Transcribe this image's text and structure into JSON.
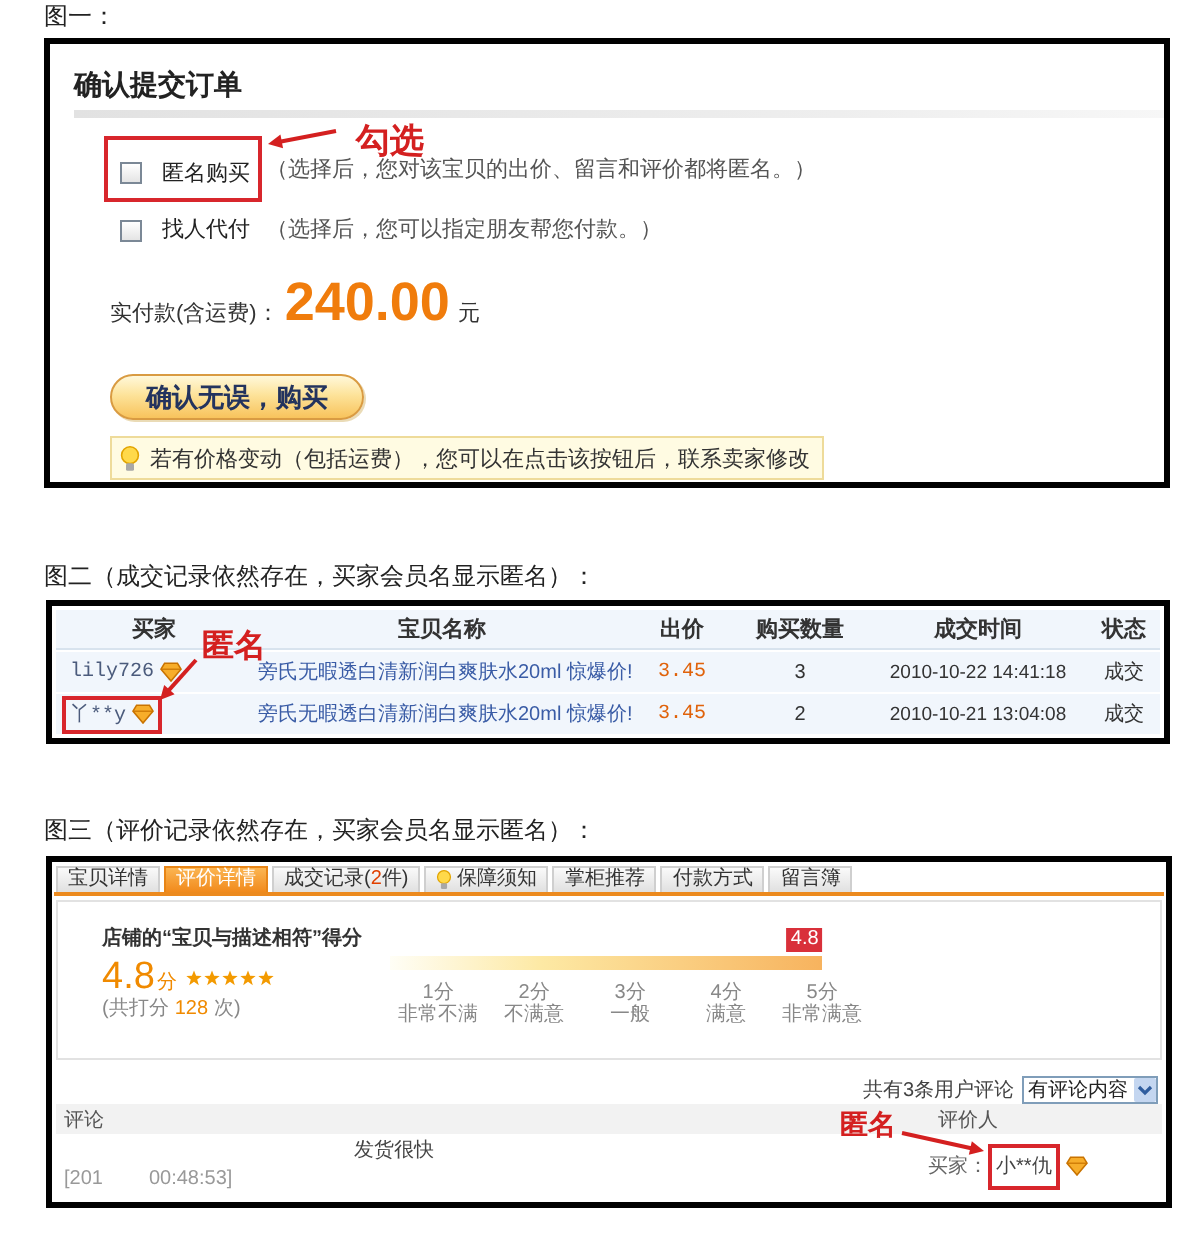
{
  "order_figure": {
    "caption": "图一：",
    "title": "确认提交订单",
    "options": [
      {
        "label": "匿名购买",
        "hint": "（选择后，您对该宝贝的出价、留言和评价都将匿名。）",
        "checked": false,
        "highlighted": true
      },
      {
        "label": "找人代付",
        "hint": "（选择后，您可以指定朋友帮您付款。）",
        "checked": false,
        "highlighted": false
      }
    ],
    "annotation": "勾选",
    "total_label": "实付款(含运费)：",
    "total_amount": "240.00",
    "currency": "元",
    "submit_button": "确认无误，购买",
    "tip": "若有价格变动（包括运费），您可以在点击该按钮后，联系卖家修改"
  },
  "records_figure": {
    "caption": "图二（成交记录依然存在，买家会员名显示匿名）：",
    "columns": [
      "买家",
      "宝贝名称",
      "出价",
      "购买数量",
      "成交时间",
      "状态"
    ],
    "rows": [
      {
        "buyer": "lily726",
        "item": "旁氏无暇透白清新润白爽肤水20ml 惊爆价!",
        "price": "3.45",
        "quantity": "3",
        "time": "2010-10-22 14:41:18",
        "status": "成交",
        "highlighted": false
      },
      {
        "buyer": "丫**y",
        "item": "旁氏无暇透白清新润白爽肤水20ml 惊爆价!",
        "price": "3.45",
        "quantity": "2",
        "time": "2010-10-21 13:04:08",
        "status": "成交",
        "highlighted": true
      }
    ],
    "annotation": "匿名"
  },
  "reviews_figure": {
    "caption": "图三（评价记录依然存在，买家会员名显示匿名）：",
    "tabs": [
      {
        "kind": "text",
        "label": "宝贝详情",
        "selected": false
      },
      {
        "kind": "text",
        "label": "评价详情",
        "selected": true
      },
      {
        "kind": "counted",
        "label": "成交记录(",
        "count": "2",
        "suffix": "件)",
        "selected": false
      },
      {
        "kind": "icon",
        "label": "保障须知",
        "selected": false
      },
      {
        "kind": "text",
        "label": "掌柜推荐",
        "selected": false
      },
      {
        "kind": "text",
        "label": "付款方式",
        "selected": false
      },
      {
        "kind": "text",
        "label": "留言簿",
        "selected": false
      }
    ],
    "rating": {
      "title": "店铺的“宝贝与描述相符”得分",
      "score": "4.8",
      "unit": "分",
      "stars": 5,
      "count_prefix": "(共打分",
      "count": "128",
      "count_suffix": "次)"
    },
    "scale": {
      "level": 0.96,
      "marker": "4.8",
      "ticks": [
        {
          "score": "1分",
          "label": "非常不满"
        },
        {
          "score": "2分",
          "label": "不满意"
        },
        {
          "score": "3分",
          "label": "一般"
        },
        {
          "score": "4分",
          "label": "满意"
        },
        {
          "score": "5分",
          "label": "非常满意"
        }
      ]
    },
    "comment_total": "共有3条用户评论",
    "filter": "有评论内容",
    "columns": [
      "评论",
      "评价人"
    ],
    "comments": [
      {
        "text": "发货很快",
        "date": "[201",
        "time": "00:48:53]",
        "reviewer_label": "买家：",
        "reviewer": "小**仇",
        "highlighted": true
      }
    ],
    "annotation": "匿名"
  }
}
